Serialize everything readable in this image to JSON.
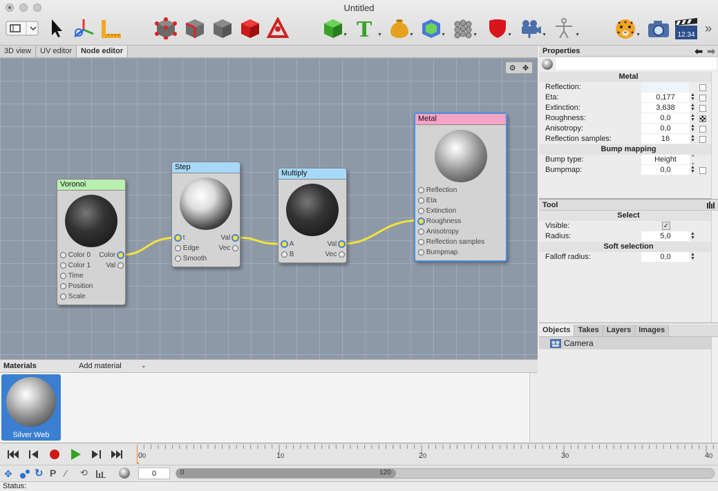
{
  "window": {
    "title": "Untitled"
  },
  "toolbar": {
    "tools": [
      {
        "icon": "layout-icon"
      },
      {
        "icon": "arrow-pointer-icon"
      },
      {
        "icon": "transform-axes-icon"
      },
      {
        "icon": "ruler-icon"
      },
      {
        "icon": "vertex-mode-icon"
      },
      {
        "icon": "edge-mode-icon"
      },
      {
        "icon": "face-mode-icon"
      },
      {
        "icon": "object-mode-icon"
      },
      {
        "icon": "skeleton-mode-icon"
      },
      {
        "icon": "cube-icon"
      },
      {
        "icon": "text-icon"
      },
      {
        "icon": "vase-icon"
      },
      {
        "icon": "nurbs-cube-icon"
      },
      {
        "icon": "cloner-icon"
      },
      {
        "icon": "deformer-shield-icon"
      },
      {
        "icon": "camera-rig-icon"
      },
      {
        "icon": "figure-icon"
      },
      {
        "icon": "render-cheetah-icon"
      },
      {
        "icon": "snapshot-camera-icon"
      },
      {
        "icon": "animation-clapper-icon"
      },
      {
        "icon": "overflow-chevron-icon"
      }
    ],
    "clapper_time": "12:34",
    "overflow": "»"
  },
  "editor_tabs": [
    "3D view",
    "UV editor",
    "Node editor"
  ],
  "active_editor_tab": "Node editor",
  "nodes": {
    "voronoi": {
      "title": "Voronoi",
      "header_color": "#b9f0b0",
      "inputs": [
        "Color 0",
        "Color 1",
        "Time",
        "Position",
        "Scale"
      ],
      "outputs": [
        "Color",
        "Val"
      ]
    },
    "step": {
      "title": "Step",
      "header_color": "#a7d8f7",
      "inputs": [
        "t",
        "Edge",
        "Smooth"
      ],
      "outputs": [
        "Val",
        "Vec"
      ]
    },
    "multiply": {
      "title": "Multiply",
      "header_color": "#a7d8f7",
      "inputs": [
        "A",
        "B"
      ],
      "outputs": [
        "Val",
        "Vec"
      ]
    },
    "metal": {
      "title": "Metal",
      "header_color": "#f5a3c6",
      "inputs": [
        "Reflection",
        "Eta",
        "Extinction",
        "Roughness",
        "Anisotropy",
        "Reflection samples",
        "Bumpmap"
      ]
    }
  },
  "materials": {
    "title": "Materials",
    "add_label": "Add material",
    "items": [
      {
        "name": "Silver Web"
      }
    ]
  },
  "timeline": {
    "labels": [
      "0",
      "1",
      "2",
      "3",
      "4"
    ],
    "sublabel": "0",
    "frame": "0",
    "range_start": "0",
    "range_end": "120"
  },
  "status": {
    "label": "Status:"
  },
  "properties": {
    "title": "Properties",
    "material_name": "Metal",
    "rows": [
      {
        "label": "Reflection:",
        "value": "",
        "has_spin": false,
        "check": "empty"
      },
      {
        "label": "Eta:",
        "value": "0,177",
        "has_spin": true,
        "check": "empty"
      },
      {
        "label": "Extinction:",
        "value": "3,638",
        "has_spin": true,
        "check": "empty"
      },
      {
        "label": "Roughness:",
        "value": "0,0",
        "has_spin": true,
        "check": "texture"
      },
      {
        "label": "Anisotropy:",
        "value": "0,0",
        "has_spin": true,
        "check": "empty"
      },
      {
        "label": "Reflection samples:",
        "value": "16",
        "has_spin": true,
        "check": "empty"
      }
    ],
    "bump_section": "Bump mapping",
    "bump_type_label": "Bump type:",
    "bump_type_value": "Height",
    "bumpmap_label": "Bumpmap:",
    "bumpmap_value": "0,0"
  },
  "tool": {
    "title": "Tool",
    "section": "Select",
    "visible_label": "Visible:",
    "visible_checked": true,
    "radius_label": "Radius:",
    "radius_value": "5,0",
    "soft_section": "Soft selection",
    "falloff_label": "Falloff radius:",
    "falloff_value": "0,0"
  },
  "objects": {
    "tabs": [
      "Objects",
      "Takes",
      "Layers",
      "Images"
    ],
    "active_tab": "Objects",
    "items": [
      {
        "name": "Camera"
      }
    ]
  },
  "colors": {
    "canvas": "#8e99a8",
    "wire": "#f3e33a",
    "selection": "#3a7fd0"
  }
}
